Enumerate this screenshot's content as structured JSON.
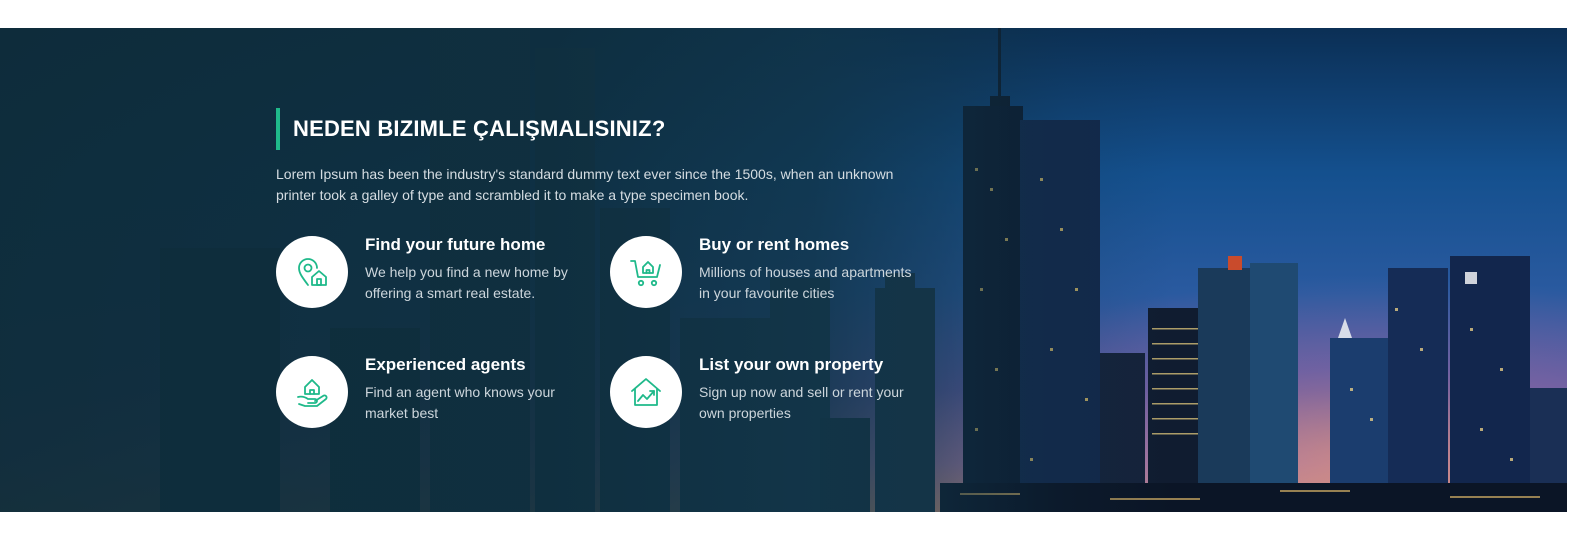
{
  "section": {
    "title": "NEDEN BIZIMLE ÇALIŞMALISINIZ?",
    "intro": "Lorem Ipsum has been the industry's standard dummy text ever since the 1500s, when an unknown printer took a galley of type and scrambled it to make a type specimen book."
  },
  "features": [
    {
      "title": "Find your future home",
      "description": "We help you find a new home by offering a smart real estate.",
      "icon": "location-home-icon"
    },
    {
      "title": "Buy or rent homes",
      "description": "Millions of houses and apartments in your favourite cities",
      "icon": "cart-home-icon"
    },
    {
      "title": "Experienced agents",
      "description": "Find an agent who knows your market best",
      "icon": "hand-home-icon"
    },
    {
      "title": "List your own property",
      "description": "Sign up now and sell or rent your own properties",
      "icon": "home-growth-icon"
    }
  ],
  "colors": {
    "accent": "#1fb98a",
    "hero_dark": "#0e2c3a",
    "text_light": "#ffffff"
  }
}
